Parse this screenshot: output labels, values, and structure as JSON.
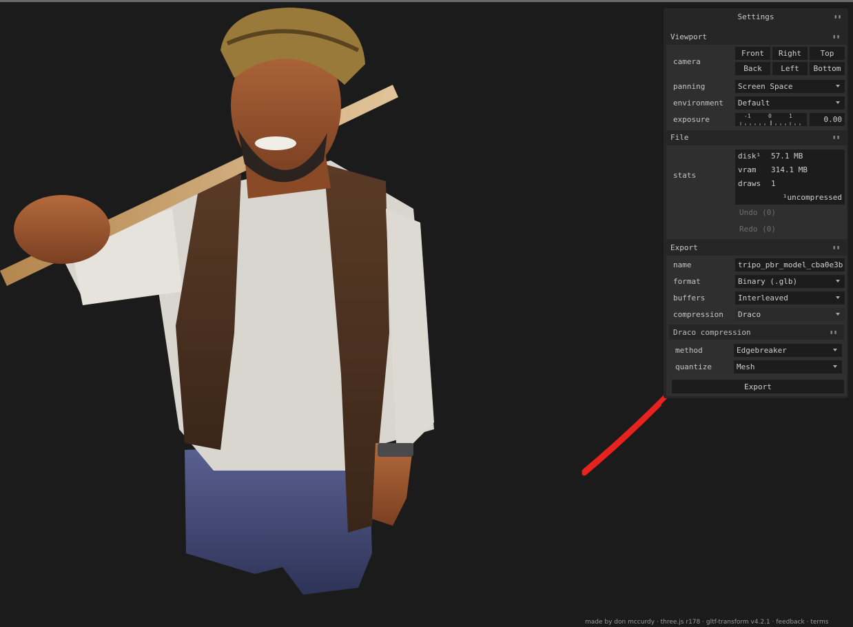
{
  "panel": {
    "title": "Settings",
    "grip_icon": "grip-icon",
    "viewport": {
      "header": "Viewport",
      "camera": {
        "label": "camera",
        "buttons": [
          "Front",
          "Right",
          "Top",
          "Back",
          "Left",
          "Bottom"
        ]
      },
      "panning": {
        "label": "panning",
        "value": "Screen Space"
      },
      "environment": {
        "label": "environment",
        "value": "Default"
      },
      "exposure": {
        "label": "exposure",
        "ticks": [
          "-1",
          "0",
          "1"
        ],
        "value": "0.00"
      }
    },
    "file": {
      "header": "File",
      "stats": {
        "label": "stats",
        "disk_key": "disk¹",
        "disk_val": "57.1 MB",
        "vram_key": "vram",
        "vram_val": "314.1 MB",
        "draws_key": "draws",
        "draws_val": "1",
        "note": "¹uncompressed"
      },
      "undo": "Undo (0)",
      "redo": "Redo (0)"
    },
    "export": {
      "header": "Export",
      "name": {
        "label": "name",
        "value": "tripo_pbr_model_cba0e3b"
      },
      "format": {
        "label": "format",
        "value": "Binary (.glb)"
      },
      "buffers": {
        "label": "buffers",
        "value": "Interleaved"
      },
      "compression": {
        "label": "compression",
        "value": "Draco"
      },
      "draco": {
        "header": "Draco compression",
        "method": {
          "label": "method",
          "value": "Edgebreaker"
        },
        "quantize": {
          "label": "quantize",
          "value": "Mesh"
        }
      },
      "button": "Export"
    }
  },
  "footer": {
    "made_by": "made by don mccurdy",
    "threejs": "three.js r178",
    "gltf": "gltf-transform v4.2.1",
    "feedback": "feedback",
    "terms": "terms",
    "sep": "·"
  },
  "colors": {
    "annotation": "#e8231f",
    "background": "#1b1b1b",
    "panel": "#262626"
  }
}
